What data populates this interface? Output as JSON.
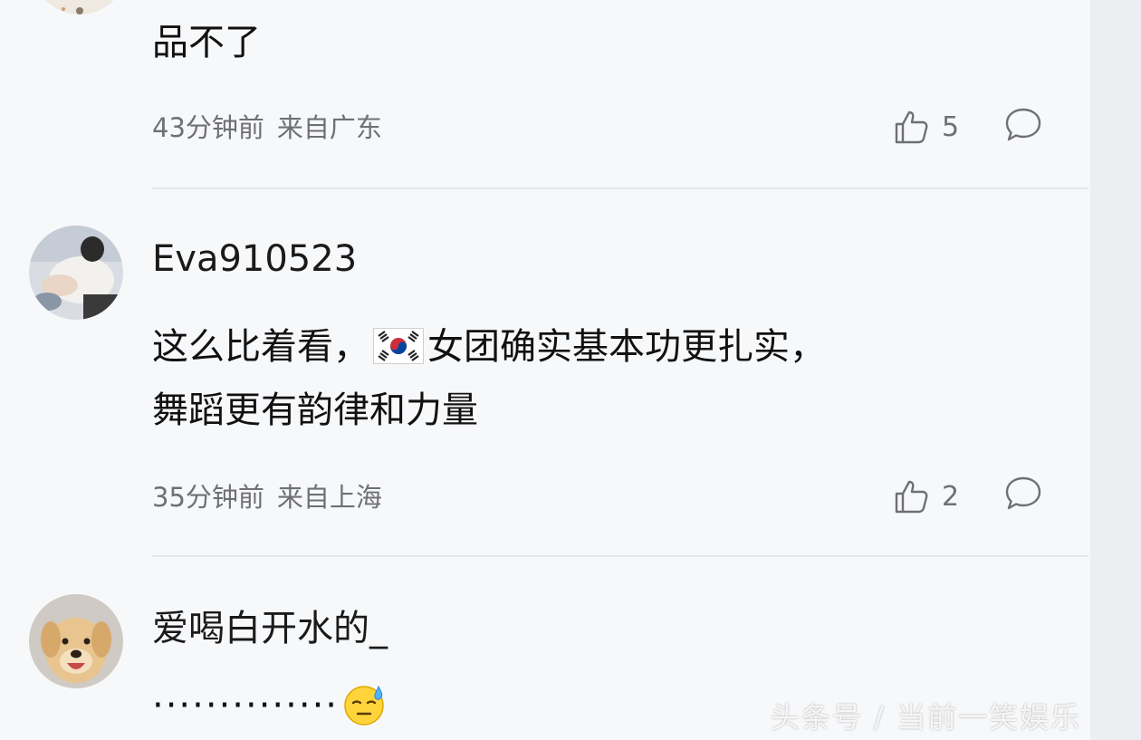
{
  "comments": [
    {
      "content": "品不了",
      "time": "43分钟前",
      "location": "来自广东",
      "likes": "5"
    },
    {
      "username": "Eva910523",
      "content_part1": "这么比着看，",
      "flag_icon": "south-korea-flag",
      "content_part2": "女团确实基本功更扎实，",
      "content_line2": "舞蹈更有韵律和力量",
      "time": "35分钟前",
      "location": "来自上海",
      "likes": "2"
    },
    {
      "username": "爱喝白开水的_",
      "content": "··············",
      "emoji_icon": "cold-sweat-emoji"
    }
  ],
  "watermark": "头条号 / 当前一笑娱乐",
  "colors": {
    "background": "#f7f8fa",
    "meta_text": "#6f6f76",
    "divider": "#e6e7ea"
  }
}
